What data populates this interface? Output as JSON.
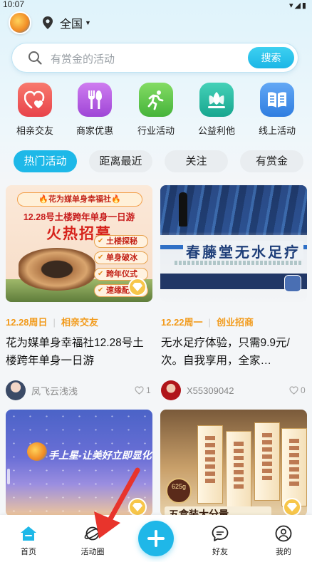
{
  "status_bar": {
    "time": "10:07"
  },
  "header": {
    "location": "全国"
  },
  "search": {
    "placeholder": "有赏金的活动",
    "button": "搜索"
  },
  "categories": [
    {
      "label": "相亲交友",
      "icon": "heart-icon",
      "color": "#ef5b5b"
    },
    {
      "label": "商家优惠",
      "icon": "cutlery-icon",
      "color": "#b85be0"
    },
    {
      "label": "行业活动",
      "icon": "runner-icon",
      "color": "#5cc24a"
    },
    {
      "label": "公益利他",
      "icon": "lotus-icon",
      "color": "#26b7a3"
    },
    {
      "label": "线上活动",
      "icon": "book-icon",
      "color": "#3c8be3"
    }
  ],
  "tabs": [
    {
      "label": "热门活动",
      "active": true
    },
    {
      "label": "距离最近",
      "active": false
    },
    {
      "label": "关注",
      "active": false
    },
    {
      "label": "有赏金",
      "active": false
    }
  ],
  "feed": [
    {
      "poster": {
        "banner": "🔥花为媒单身幸福社🔥",
        "line2": "12.28号土楼跨年单身一日游",
        "headline": "火热招募",
        "tags": [
          "土楼探秘",
          "单身破冰",
          "跨年仪式",
          "速缘配对"
        ]
      },
      "date": "12.28周日",
      "category": "相亲交友",
      "title": "花为媒单身幸福社12.28号土楼跨年单身一日游",
      "author": "凤飞云浅浅",
      "likes": "1"
    },
    {
      "poster": {
        "headline": "春藤堂无水足疗"
      },
      "date": "12.22周一",
      "category": "创业招商",
      "title": "无水足疗体验，只需9.9元/次。自我享用，全家…",
      "author": "X55309042",
      "likes": "0"
    },
    {
      "poster": {
        "slogan": "手上星-让美好立即显化"
      }
    },
    {
      "poster": {
        "seal": "625g",
        "band": "五盒装大分量"
      }
    }
  ],
  "bottom_nav": [
    {
      "label": "首页",
      "icon": "home-icon",
      "active": true
    },
    {
      "label": "活动圈",
      "icon": "planet-icon",
      "active": false
    },
    {
      "label": "好友",
      "icon": "chat-icon",
      "active": false
    },
    {
      "label": "我的",
      "icon": "user-icon",
      "active": false
    }
  ],
  "colors": {
    "accent": "#1eb8e8",
    "date_orange": "#f29a1a",
    "annotation_arrow": "#e8342c"
  }
}
